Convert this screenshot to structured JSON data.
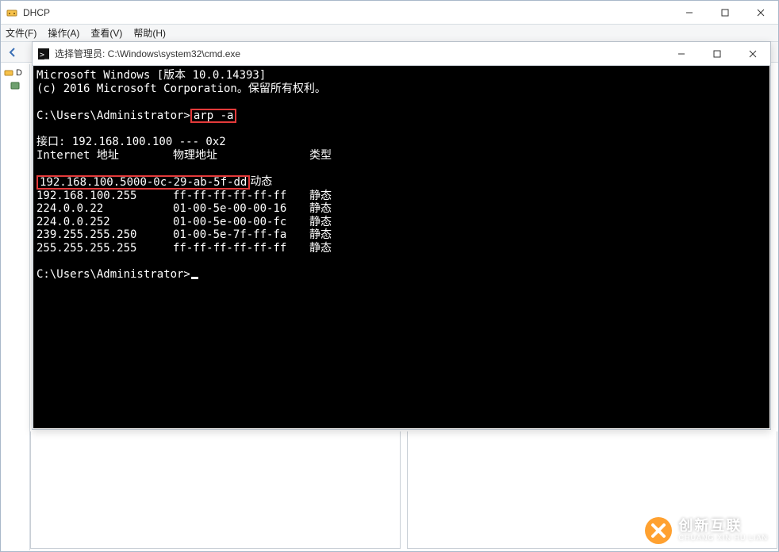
{
  "outer_window": {
    "title": "DHCP",
    "menubar": {
      "file": "文件(F)",
      "action": "操作(A)",
      "view": "查看(V)",
      "help": "帮助(H)"
    },
    "tree": {
      "root": "D",
      "child": ""
    }
  },
  "cmd_window": {
    "title": "选择管理员: C:\\Windows\\system32\\cmd.exe",
    "banner_line1": "Microsoft Windows [版本 10.0.14393]",
    "banner_line2": "(c) 2016 Microsoft Corporation。保留所有权利。",
    "prompt1_prefix": "C:\\Users\\Administrator>",
    "prompt1_cmd": "arp -a",
    "interface_line": "接口: 192.168.100.100 --- 0x2",
    "header_ip": "Internet 地址",
    "header_mac": "物理地址",
    "header_type": "类型",
    "arp_rows": [
      {
        "ip": "192.168.100.50",
        "mac": "00-0c-29-ab-5f-dd",
        "type": "动态",
        "highlight": true
      },
      {
        "ip": "192.168.100.255",
        "mac": "ff-ff-ff-ff-ff-ff",
        "type": "静态",
        "highlight": false
      },
      {
        "ip": "224.0.0.22",
        "mac": "01-00-5e-00-00-16",
        "type": "静态",
        "highlight": false
      },
      {
        "ip": "224.0.0.252",
        "mac": "01-00-5e-00-00-fc",
        "type": "静态",
        "highlight": false
      },
      {
        "ip": "239.255.255.250",
        "mac": "01-00-5e-7f-ff-fa",
        "type": "静态",
        "highlight": false
      },
      {
        "ip": "255.255.255.255",
        "mac": "ff-ff-ff-ff-ff-ff",
        "type": "静态",
        "highlight": false
      }
    ],
    "prompt2": "C:\\Users\\Administrator>"
  },
  "watermark": {
    "logo": "✕",
    "line1": "创新互联",
    "line2": "CHUANG XIN HU LIAN"
  }
}
